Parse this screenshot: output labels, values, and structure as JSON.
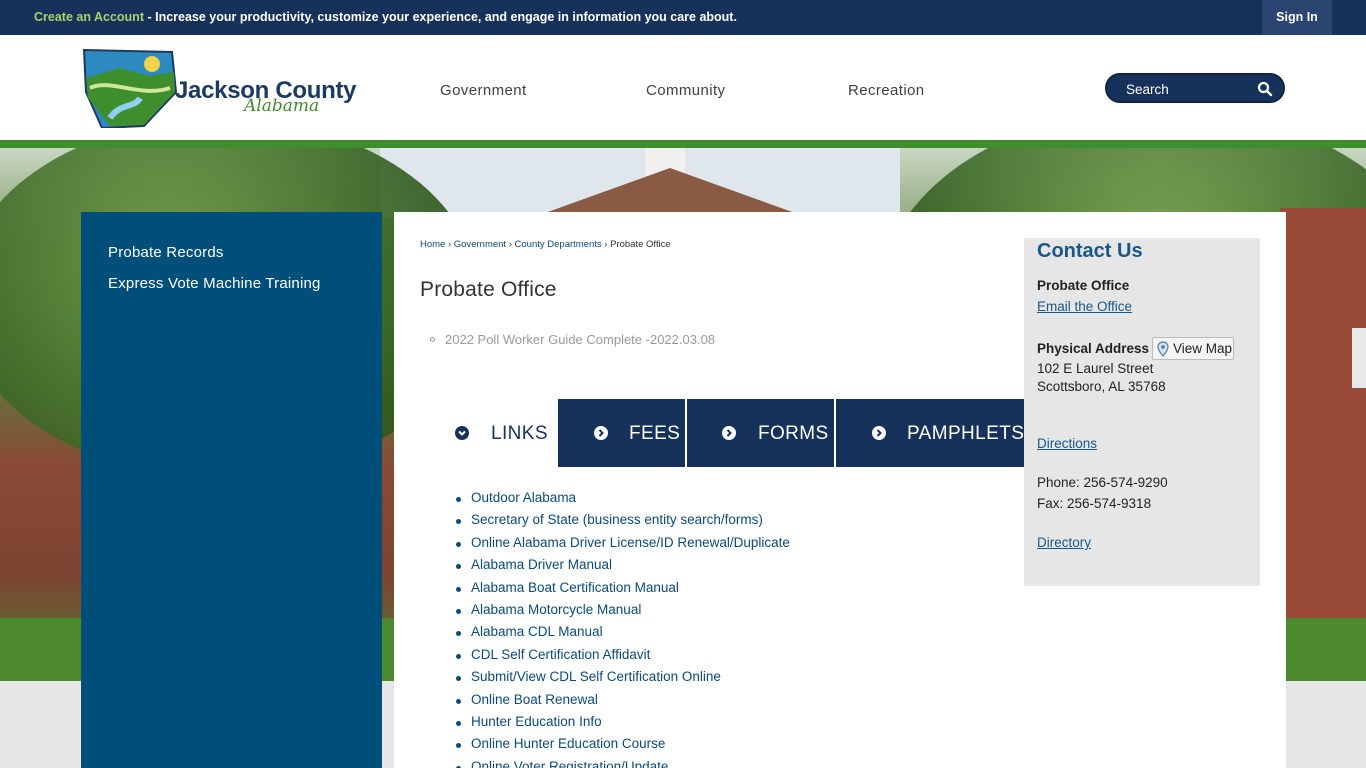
{
  "topbar": {
    "create_account": "Create an Account",
    "promo_text": " - Increase your productivity, customize your experience, and engage in information you care about.",
    "sign_in": "Sign In"
  },
  "header": {
    "logo_title": "Jackson County",
    "logo_sub": "Alabama",
    "nav": [
      "Government",
      "Community",
      "Recreation"
    ],
    "search_placeholder": "Search"
  },
  "sidebar": {
    "items": [
      "Probate Records",
      "Express Vote Machine Training"
    ]
  },
  "breadcrumb": {
    "items": [
      "Home",
      "Government",
      "County Departments"
    ],
    "current": "Probate Office",
    "sep": "›"
  },
  "main": {
    "title": "Probate Office",
    "guide_link": "2022 Poll Worker Guide Complete -2022.03.08",
    "tabs": [
      "LINKS",
      "FEES",
      "FORMS",
      "PAMPHLETS"
    ],
    "links": [
      "Outdoor Alabama",
      "Secretary of State (business entity search/forms)",
      "Online Alabama Driver License/ID Renewal/Duplicate",
      "Alabama Driver Manual",
      "Alabama Boat Certification Manual",
      "Alabama Motorcycle Manual",
      "Alabama CDL Manual",
      "CDL Self Certification Affidavit",
      "Submit/View CDL Self Certification Online",
      "Online Boat Renewal",
      "Hunter Education Info",
      "Online Hunter Education Course",
      "Online Voter Registration/Update"
    ]
  },
  "contact": {
    "title": "Contact Us",
    "office": "Probate Office",
    "email": "Email the Office",
    "physical_address_label": "Physical Address",
    "view_map": "View Map",
    "street": "102 E Laurel Street",
    "city": "Scottsboro, AL 35768",
    "directions": "Directions",
    "phone": "Phone: 256-574-9290",
    "fax": "Fax: 256-574-9318",
    "directory": "Directory"
  },
  "colors": {
    "navy": "#17325a",
    "sidebar_blue": "#004e7a",
    "accent_green": "#3e8e2d",
    "link_blue": "#0b4a7a"
  }
}
